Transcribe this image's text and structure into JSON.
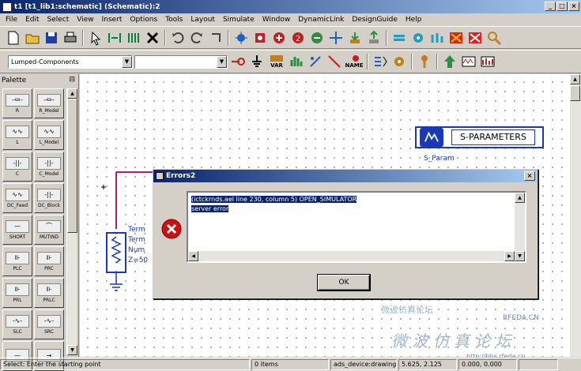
{
  "window": {
    "title": "t1 [t1_lib1:schematic] (Schematic):2"
  },
  "menu": [
    "File",
    "Edit",
    "Select",
    "View",
    "Insert",
    "Options",
    "Tools",
    "Layout",
    "Simulate",
    "Window",
    "DynamicLink",
    "DesignGuide",
    "Help"
  ],
  "toolbar2": {
    "library_combo": "Lumped-Components",
    "component_combo": "",
    "var_label": "VAR",
    "name_label": "NAME"
  },
  "palette": {
    "title": "Palette",
    "items": [
      "R",
      "R_Model",
      "L",
      "L_Model",
      "C",
      "C_Model",
      "DC_Feed",
      "DC_Block",
      "SHORT",
      "MUTIND",
      "PLC",
      "PRC",
      "PRL",
      "PRLC",
      "SLC",
      "SRC",
      "",
      ""
    ]
  },
  "schematic": {
    "sparam_title": "S-PARAMETERS",
    "sparam_sub": "S_Param",
    "term_lines": [
      "Term",
      "Term",
      "Num",
      "Z=50"
    ]
  },
  "dialog": {
    "title": "Errors2",
    "lines": [
      "(ictckrnds.ael line 230, column 5) OPEN_SIMULATOR",
      "server error"
    ],
    "ok_label": "OK"
  },
  "watermark": {
    "line1": "微波仿真论坛",
    "line2": "RFEDA.CN",
    "line3": "微 波 仿 真 论 坛",
    "line4": "http://bbs.rfeda.cn"
  },
  "status": {
    "message": "Select: Enter the starting point",
    "items": "0 items",
    "view": "ads_device:drawing",
    "coords": "5.625, 2.125",
    "extra": "0.000, 0.000"
  }
}
